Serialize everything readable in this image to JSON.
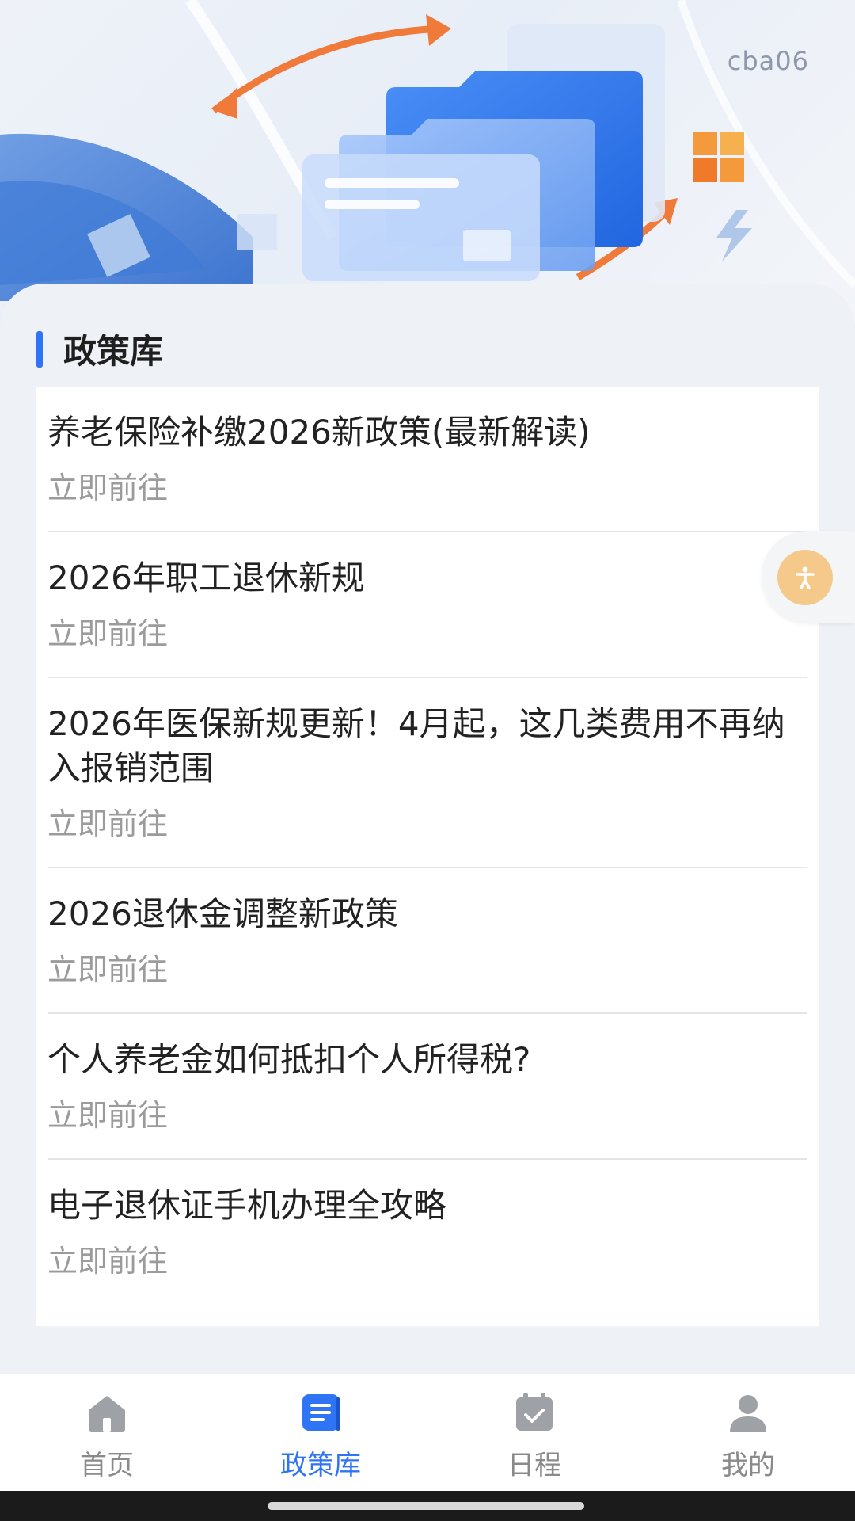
{
  "header": {
    "user_code": "cba06"
  },
  "section": {
    "title": "政策库"
  },
  "articles": [
    {
      "title": "养老保险补缴2026新政策(最新解读)",
      "link_label": "立即前往"
    },
    {
      "title": "2026年职工退休新规",
      "link_label": "立即前往"
    },
    {
      "title": "2026年医保新规更新！4月起，这几类费用不再纳入报销范围",
      "link_label": "立即前往"
    },
    {
      "title": "2026退休金调整新政策",
      "link_label": "立即前往"
    },
    {
      "title": "个人养老金如何抵扣个人所得税?",
      "link_label": "立即前往"
    },
    {
      "title": "电子退休证手机办理全攻略",
      "link_label": "立即前往"
    }
  ],
  "floating_button": {
    "icon": "accessibility-icon"
  },
  "tabbar": {
    "tabs": [
      {
        "label": "首页",
        "icon": "home-icon"
      },
      {
        "label": "政策库",
        "icon": "policy-library-icon",
        "active": true
      },
      {
        "label": "日程",
        "icon": "calendar-icon"
      },
      {
        "label": "我的",
        "icon": "profile-icon"
      }
    ]
  },
  "colors": {
    "accent": "#2f74f4",
    "inactive_tab": "#9ea1a6",
    "float_button": "#f5c98a"
  }
}
